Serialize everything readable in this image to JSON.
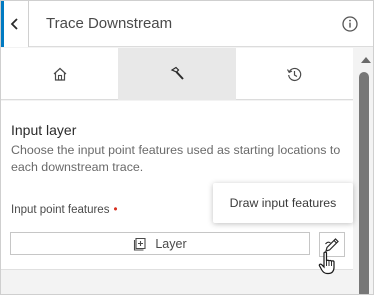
{
  "header": {
    "title": "Trace Downstream",
    "back_icon": "chevron-left-icon",
    "info_icon": "info-icon"
  },
  "tabs": [
    {
      "icon": "home-icon",
      "active": false
    },
    {
      "icon": "hammer-icon",
      "active": true
    },
    {
      "icon": "history-icon",
      "active": false
    }
  ],
  "section": {
    "title": "Input layer",
    "description": "Choose the input point features used as starting locations to each downstream trace."
  },
  "field": {
    "label": "Input point features",
    "required_mark": "•",
    "layer_button_label": "Layer",
    "layer_icon": "add-layer-icon",
    "draw_icon": "draw-pen-icon"
  },
  "tooltip": {
    "text": "Draw input features"
  },
  "colors": {
    "accent": "#007ac2",
    "required": "#d83020"
  }
}
